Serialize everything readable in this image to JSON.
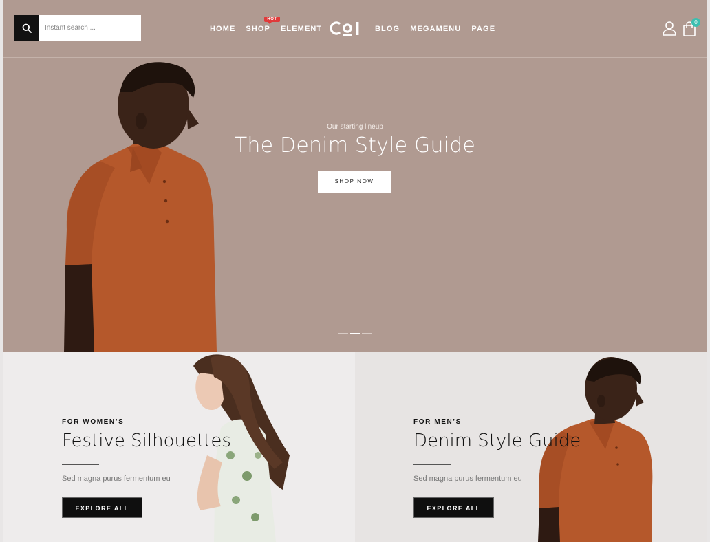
{
  "header": {
    "search": {
      "placeholder": "Instant search ..."
    },
    "nav_left": [
      {
        "label": "HOME"
      },
      {
        "label": "SHOP",
        "badge": "HOT"
      },
      {
        "label": "ELEMENT"
      }
    ],
    "logo_text": "COI",
    "nav_right": [
      {
        "label": "BLOG"
      },
      {
        "label": "MEGAMENU"
      },
      {
        "label": "PAGE"
      }
    ],
    "cart_count": "0",
    "icons": [
      "search-icon",
      "user-icon",
      "shopping-bag-icon"
    ]
  },
  "hero": {
    "subtitle": "Our starting lineup",
    "title": "The Denim Style Guide",
    "button": "SHOP NOW",
    "slides": 3,
    "active_slide": 2
  },
  "panels": [
    {
      "eyebrow": "FOR WOMEN’S",
      "title": "Festive Silhouettes",
      "desc": "Sed magna purus fermentum eu",
      "button": "EXPLORE ALL"
    },
    {
      "eyebrow": "FOR MEN’S",
      "title": "Denim Style Guide",
      "desc": "Sed magna purus fermentum eu",
      "button": "EXPLORE ALL"
    }
  ],
  "colors": {
    "hero_bg": "#b09a91",
    "accent_hot": "#e03a3a",
    "cart_badge": "#3bbfb0",
    "shirt": "#b5582b"
  }
}
